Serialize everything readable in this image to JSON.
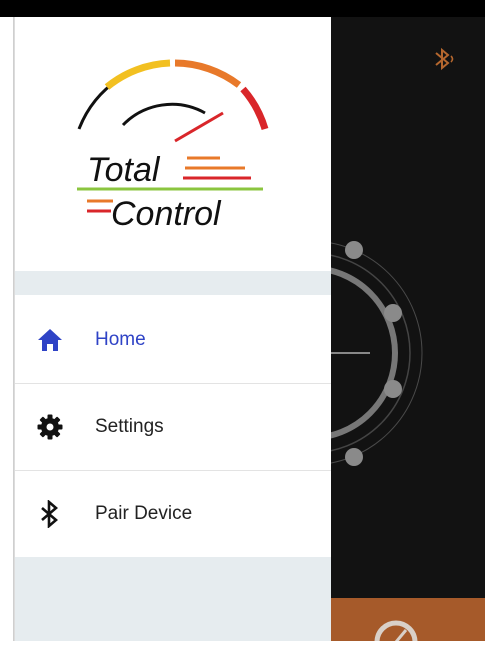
{
  "logo": {
    "line1": "Total",
    "line2": "Control"
  },
  "menu": {
    "items": [
      {
        "label": "Home",
        "icon": "home-icon",
        "active": true
      },
      {
        "label": "Settings",
        "icon": "gear-icon",
        "active": false
      },
      {
        "label": "Pair Device",
        "icon": "bluetooth-icon",
        "active": false
      }
    ]
  },
  "colors": {
    "active": "#2f43c6",
    "accent_orange": "#e8792a",
    "gauge_red": "#d9262a",
    "gauge_yellow": "#f2c021",
    "logo_green": "#8bc53f",
    "app_background": "#121212"
  }
}
